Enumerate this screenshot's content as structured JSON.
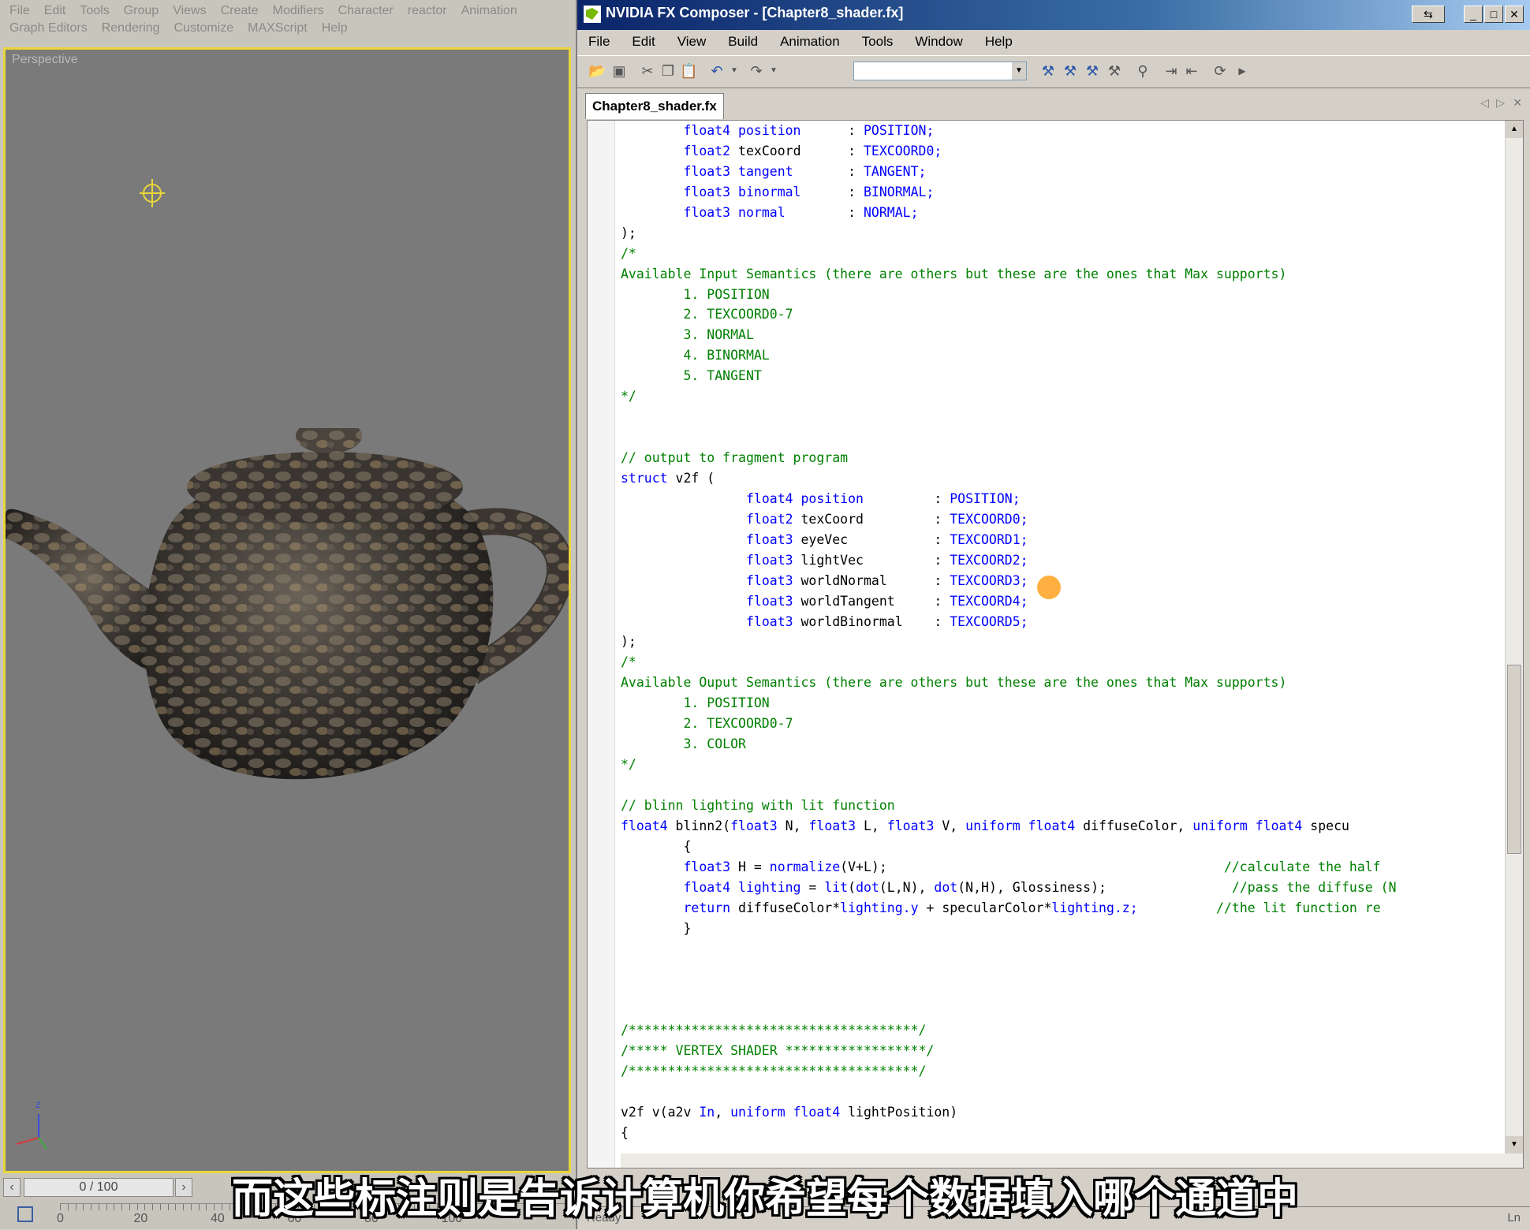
{
  "max": {
    "menu_row1": [
      "File",
      "Edit",
      "Tools",
      "Group",
      "Views",
      "Create",
      "Modifiers",
      "Character",
      "reactor",
      "Animation"
    ],
    "menu_row2": [
      "Graph Editors",
      "Rendering",
      "Customize",
      "MAXScript",
      "Help"
    ],
    "viewport_label": "Perspective",
    "frame_counter": "0 / 100",
    "ruler_labels": [
      "0",
      "20",
      "40",
      "60",
      "80",
      "100"
    ],
    "axis_z": "z"
  },
  "fx": {
    "title": "NVIDIA FX Composer - [Chapter8_shader.fx]",
    "menu": [
      "File",
      "Edit",
      "View",
      "Build",
      "Animation",
      "Tools",
      "Window",
      "Help"
    ],
    "tab": "Chapter8_shader.fx",
    "status_left": "Ready",
    "status_right": "Ln",
    "code_lines": [
      [
        {
          "t": "        "
        },
        {
          "t": "float4 position",
          "c": "kw"
        },
        {
          "t": "      : "
        },
        {
          "t": "POSITION;",
          "c": "kw"
        }
      ],
      [
        {
          "t": "        "
        },
        {
          "t": "float2",
          "c": "kw"
        },
        {
          "t": " texCoord      : "
        },
        {
          "t": "TEXCOORD0;",
          "c": "kw"
        }
      ],
      [
        {
          "t": "        "
        },
        {
          "t": "float3 tangent",
          "c": "kw"
        },
        {
          "t": "       : "
        },
        {
          "t": "TANGENT;",
          "c": "kw"
        }
      ],
      [
        {
          "t": "        "
        },
        {
          "t": "float3 binormal",
          "c": "kw"
        },
        {
          "t": "      : "
        },
        {
          "t": "BINORMAL;",
          "c": "kw"
        }
      ],
      [
        {
          "t": "        "
        },
        {
          "t": "float3 normal",
          "c": "kw"
        },
        {
          "t": "        : "
        },
        {
          "t": "NORMAL;",
          "c": "kw"
        }
      ],
      [
        {
          "t": ");"
        }
      ],
      [
        {
          "t": "/*",
          "c": "cm"
        }
      ],
      [
        {
          "t": "Available Input Semantics (there are others but these are the ones that Max supports)",
          "c": "cm"
        }
      ],
      [
        {
          "t": "        1. POSITION",
          "c": "cm"
        }
      ],
      [
        {
          "t": "        2. TEXCOORD0-7",
          "c": "cm"
        }
      ],
      [
        {
          "t": "        3. NORMAL",
          "c": "cm"
        }
      ],
      [
        {
          "t": "        4. BINORMAL",
          "c": "cm"
        }
      ],
      [
        {
          "t": "        5. TANGENT",
          "c": "cm"
        }
      ],
      [
        {
          "t": "*/",
          "c": "cm"
        }
      ],
      [
        {
          "t": ""
        }
      ],
      [
        {
          "t": ""
        }
      ],
      [
        {
          "t": "// output to fragment program",
          "c": "cm"
        }
      ],
      [
        {
          "t": "struct",
          "c": "kw"
        },
        {
          "t": " v2f ("
        }
      ],
      [
        {
          "t": "                "
        },
        {
          "t": "float4 position",
          "c": "kw"
        },
        {
          "t": "         : "
        },
        {
          "t": "POSITION;",
          "c": "kw"
        }
      ],
      [
        {
          "t": "                "
        },
        {
          "t": "float2",
          "c": "kw"
        },
        {
          "t": " texCoord         : "
        },
        {
          "t": "TEXCOORD0;",
          "c": "kw"
        }
      ],
      [
        {
          "t": "                "
        },
        {
          "t": "float3",
          "c": "kw"
        },
        {
          "t": " eyeVec           : "
        },
        {
          "t": "TEXCOORD1;",
          "c": "kw"
        }
      ],
      [
        {
          "t": "                "
        },
        {
          "t": "float3",
          "c": "kw"
        },
        {
          "t": " lightVec         : "
        },
        {
          "t": "TEXCOORD2;",
          "c": "kw"
        }
      ],
      [
        {
          "t": "                "
        },
        {
          "t": "float3",
          "c": "kw"
        },
        {
          "t": " worldNormal      : "
        },
        {
          "t": "TEXCOORD3;",
          "c": "kw"
        }
      ],
      [
        {
          "t": "                "
        },
        {
          "t": "float3",
          "c": "kw"
        },
        {
          "t": " worldTangent     : "
        },
        {
          "t": "TEXCOORD4;",
          "c": "kw"
        }
      ],
      [
        {
          "t": "                "
        },
        {
          "t": "float3",
          "c": "kw"
        },
        {
          "t": " worldBinormal    : "
        },
        {
          "t": "TEXCOORD5;",
          "c": "kw"
        }
      ],
      [
        {
          "t": ");"
        }
      ],
      [
        {
          "t": "/*",
          "c": "cm"
        }
      ],
      [
        {
          "t": "Available Ouput Semantics (there are others but these are the ones that Max supports)",
          "c": "cm"
        }
      ],
      [
        {
          "t": "        1. POSITION",
          "c": "cm"
        }
      ],
      [
        {
          "t": "        2. TEXCOORD0-7",
          "c": "cm"
        }
      ],
      [
        {
          "t": "        3. COLOR",
          "c": "cm"
        }
      ],
      [
        {
          "t": "*/",
          "c": "cm"
        }
      ],
      [
        {
          "t": ""
        }
      ],
      [
        {
          "t": "// blinn lighting with lit function",
          "c": "cm"
        }
      ],
      [
        {
          "t": "float4",
          "c": "kw"
        },
        {
          "t": " blinn2("
        },
        {
          "t": "float3",
          "c": "kw"
        },
        {
          "t": " N, "
        },
        {
          "t": "float3",
          "c": "kw"
        },
        {
          "t": " L, "
        },
        {
          "t": "float3",
          "c": "kw"
        },
        {
          "t": " V, "
        },
        {
          "t": "uniform float4",
          "c": "kw"
        },
        {
          "t": " diffuseColor, "
        },
        {
          "t": "uniform float4",
          "c": "kw"
        },
        {
          "t": " specu"
        }
      ],
      [
        {
          "t": "        {"
        }
      ],
      [
        {
          "t": "        "
        },
        {
          "t": "float3",
          "c": "kw"
        },
        {
          "t": " H = "
        },
        {
          "t": "normalize",
          "c": "kw"
        },
        {
          "t": "(V+L);                                           "
        },
        {
          "t": "//calculate the half",
          "c": "cm"
        }
      ],
      [
        {
          "t": "        "
        },
        {
          "t": "float4 lighting",
          "c": "kw"
        },
        {
          "t": " = "
        },
        {
          "t": "lit",
          "c": "kw"
        },
        {
          "t": "("
        },
        {
          "t": "dot",
          "c": "kw"
        },
        {
          "t": "(L,N), "
        },
        {
          "t": "dot",
          "c": "kw"
        },
        {
          "t": "(N,H), Glossiness);                "
        },
        {
          "t": "//pass the diffuse (N",
          "c": "cm"
        }
      ],
      [
        {
          "t": "        "
        },
        {
          "t": "return",
          "c": "kw"
        },
        {
          "t": " diffuseColor*"
        },
        {
          "t": "lighting.y",
          "c": "kw"
        },
        {
          "t": " + specularColor*"
        },
        {
          "t": "lighting.z;",
          "c": "kw"
        },
        {
          "t": "          "
        },
        {
          "t": "//the lit function re",
          "c": "cm"
        }
      ],
      [
        {
          "t": "        }"
        }
      ],
      [
        {
          "t": ""
        }
      ],
      [
        {
          "t": ""
        }
      ],
      [
        {
          "t": ""
        }
      ],
      [
        {
          "t": ""
        }
      ],
      [
        {
          "t": "/*************************************/",
          "c": "cm"
        }
      ],
      [
        {
          "t": "/***** VERTEX SHADER ******************/",
          "c": "cm"
        }
      ],
      [
        {
          "t": "/*************************************/",
          "c": "cm"
        }
      ],
      [
        {
          "t": ""
        }
      ],
      [
        {
          "t": "v2f v(a2v "
        },
        {
          "t": "In",
          "c": "kw"
        },
        {
          "t": ", "
        },
        {
          "t": "uniform float4",
          "c": "kw"
        },
        {
          "t": " lightPosition)"
        }
      ],
      [
        {
          "t": "{"
        }
      ]
    ]
  },
  "subtitle": "而这些标注则是告诉计算机你希望每个数据填入哪个通道中"
}
